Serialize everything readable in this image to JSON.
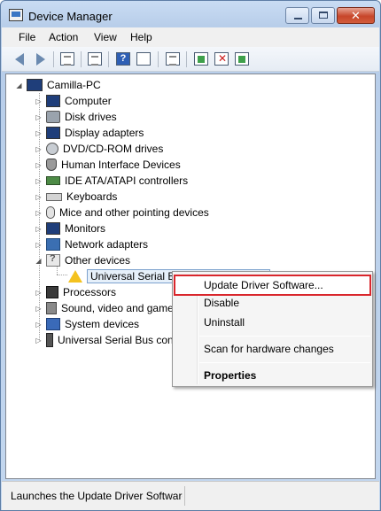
{
  "window": {
    "title": "Device Manager"
  },
  "menubar": {
    "items": [
      "File",
      "Action",
      "View",
      "Help"
    ]
  },
  "toolbar": {
    "help_glyph": "?"
  },
  "tree": {
    "root": "Camilla-PC",
    "categories": [
      {
        "label": "Computer",
        "icon": "monitor-icon"
      },
      {
        "label": "Disk drives",
        "icon": "drive-icon"
      },
      {
        "label": "Display adapters",
        "icon": "display-icon"
      },
      {
        "label": "DVD/CD-ROM drives",
        "icon": "disc-icon"
      },
      {
        "label": "Human Interface Devices",
        "icon": "hid-icon"
      },
      {
        "label": "IDE ATA/ATAPI controllers",
        "icon": "ide-icon"
      },
      {
        "label": "Keyboards",
        "icon": "keyboard-icon"
      },
      {
        "label": "Mice and other pointing devices",
        "icon": "mouse-icon"
      },
      {
        "label": "Monitors",
        "icon": "monitor-icon"
      },
      {
        "label": "Network adapters",
        "icon": "network-icon"
      },
      {
        "label": "Other devices",
        "icon": "unknown-device-icon"
      },
      {
        "label": "Universal Serial Bus (USB) Controller",
        "icon": "warning-icon"
      },
      {
        "label": "Processors",
        "icon": "processor-icon"
      },
      {
        "label": "Sound, video and game controllers",
        "icon": "sound-icon"
      },
      {
        "label": "System devices",
        "icon": "system-icon"
      },
      {
        "label": "Universal Serial Bus controllers",
        "icon": "usb-icon"
      }
    ]
  },
  "context_menu": {
    "update": "Update Driver Software...",
    "disable": "Disable",
    "uninstall": "Uninstall",
    "scan": "Scan for hardware changes",
    "properties": "Properties"
  },
  "statusbar": {
    "text": "Launches the Update Driver Software"
  },
  "colors": {
    "highlight_border": "#d9262c",
    "title_bar": "#c9dcf3"
  }
}
